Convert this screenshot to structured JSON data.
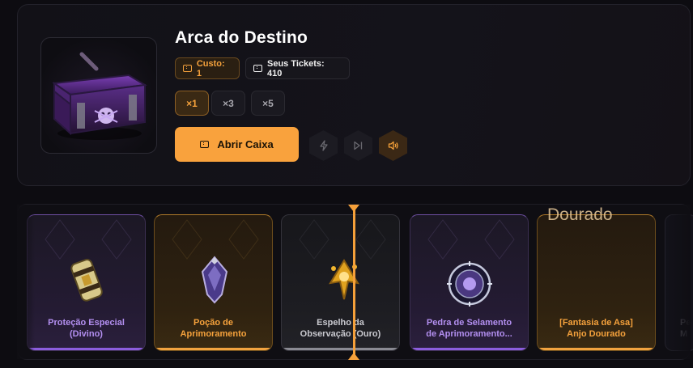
{
  "box": {
    "title": "Arca do Destino",
    "cost_label": "Custo: 1",
    "tickets_label": "Seus Tickets: 410"
  },
  "quantity": {
    "options": [
      "×1",
      "×3",
      "×5"
    ],
    "selected": "×1"
  },
  "actions": {
    "open_label": "Abrir Caixa",
    "icons": [
      "lightning-icon",
      "skip-icon",
      "sound-icon"
    ],
    "sound_enabled": true
  },
  "reel": {
    "peek_text": "Dourado",
    "items": [
      {
        "name_line1": "Proteção Especial",
        "name_line2": "(Divino)",
        "rarity": "purple",
        "icon": "scroll-bundle-icon"
      },
      {
        "name_line1": "Poção de",
        "name_line2": "Aprimoramento",
        "rarity": "gold",
        "icon": "potion-crystal-icon"
      },
      {
        "name_line1": "Espelho da",
        "name_line2": "Observação (Ouro)",
        "rarity": "gray",
        "icon": "golden-mirror-icon"
      },
      {
        "name_line1": "Pedra de Selamento",
        "name_line2": "de Aprimoramento...",
        "rarity": "purple",
        "icon": "sealing-stone-icon"
      },
      {
        "name_line1": "[Fantasia de Asa]",
        "name_line2": "Anjo Dourado",
        "rarity": "gold",
        "icon": "wing-costume-icon"
      },
      {
        "name_line1": "Pe",
        "name_line2": "M",
        "rarity": "dark",
        "icon": "partial-item-icon"
      }
    ]
  },
  "colors": {
    "accent": "#f9a23d",
    "purple": "#b38ff0",
    "gold": "#f6a23c",
    "background": "#0d0c11"
  }
}
